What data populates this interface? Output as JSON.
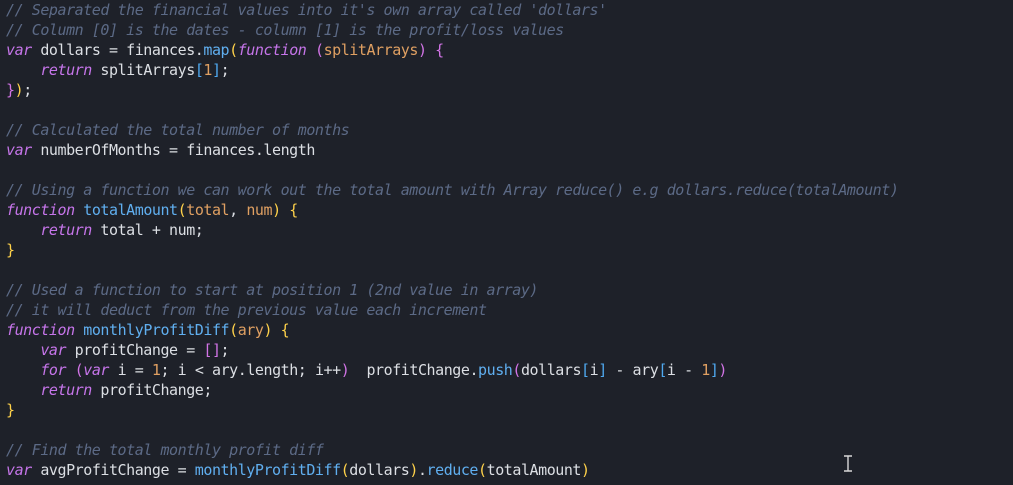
{
  "editor": {
    "lines": [
      [
        {
          "t": "// Separated the financial values into it's own array called 'dollars'",
          "c": "comment"
        }
      ],
      [
        {
          "t": "// Column [0] is the dates - column [1] is the profit/loss values",
          "c": "comment"
        }
      ],
      [
        {
          "t": "var",
          "c": "keyword"
        },
        {
          "t": " dollars = finances.",
          "c": "ident"
        },
        {
          "t": "map",
          "c": "func"
        },
        {
          "t": "(",
          "c": "p1"
        },
        {
          "t": "function",
          "c": "keyword"
        },
        {
          "t": " ",
          "c": "ident"
        },
        {
          "t": "(",
          "c": "p2"
        },
        {
          "t": "splitArrays",
          "c": "param"
        },
        {
          "t": ")",
          "c": "p2"
        },
        {
          "t": " ",
          "c": "ident"
        },
        {
          "t": "{",
          "c": "p2"
        }
      ],
      [
        {
          "t": "    ",
          "c": "ident"
        },
        {
          "t": "return",
          "c": "keyword"
        },
        {
          "t": " splitArrays",
          "c": "ident"
        },
        {
          "t": "[",
          "c": "p3"
        },
        {
          "t": "1",
          "c": "number"
        },
        {
          "t": "]",
          "c": "p3"
        },
        {
          "t": ";",
          "c": "ident"
        }
      ],
      [
        {
          "t": "}",
          "c": "p2"
        },
        {
          "t": ")",
          "c": "p1"
        },
        {
          "t": ";",
          "c": "ident"
        }
      ],
      [
        {
          "t": "",
          "c": "ident"
        }
      ],
      [
        {
          "t": "// Calculated the total number of months",
          "c": "comment"
        }
      ],
      [
        {
          "t": "var",
          "c": "keyword"
        },
        {
          "t": " numberOfMonths = finances.length",
          "c": "ident"
        }
      ],
      [
        {
          "t": "",
          "c": "ident"
        }
      ],
      [
        {
          "t": "// Using a function we can work out the total amount with Array reduce() e.g dollars.reduce(totalAmount)",
          "c": "comment"
        }
      ],
      [
        {
          "t": "function",
          "c": "keyword"
        },
        {
          "t": " ",
          "c": "ident"
        },
        {
          "t": "totalAmount",
          "c": "func"
        },
        {
          "t": "(",
          "c": "p1"
        },
        {
          "t": "total",
          "c": "param"
        },
        {
          "t": ", ",
          "c": "ident"
        },
        {
          "t": "num",
          "c": "param"
        },
        {
          "t": ")",
          "c": "p1"
        },
        {
          "t": " ",
          "c": "ident"
        },
        {
          "t": "{",
          "c": "p1"
        }
      ],
      [
        {
          "t": "    ",
          "c": "ident"
        },
        {
          "t": "return",
          "c": "keyword"
        },
        {
          "t": " total + num;",
          "c": "ident"
        }
      ],
      [
        {
          "t": "}",
          "c": "p1"
        }
      ],
      [
        {
          "t": "",
          "c": "ident"
        }
      ],
      [
        {
          "t": "// Used a function to start at position 1 (2nd value in array)",
          "c": "comment"
        }
      ],
      [
        {
          "t": "// it will deduct from the previous value each increment",
          "c": "comment"
        }
      ],
      [
        {
          "t": "function",
          "c": "keyword"
        },
        {
          "t": " ",
          "c": "ident"
        },
        {
          "t": "monthlyProfitDiff",
          "c": "func"
        },
        {
          "t": "(",
          "c": "p1"
        },
        {
          "t": "ary",
          "c": "param"
        },
        {
          "t": ")",
          "c": "p1"
        },
        {
          "t": " ",
          "c": "ident"
        },
        {
          "t": "{",
          "c": "p1"
        }
      ],
      [
        {
          "t": "    ",
          "c": "ident"
        },
        {
          "t": "var",
          "c": "keyword"
        },
        {
          "t": " profitChange = ",
          "c": "ident"
        },
        {
          "t": "[]",
          "c": "p2"
        },
        {
          "t": ";",
          "c": "ident"
        }
      ],
      [
        {
          "t": "    ",
          "c": "ident"
        },
        {
          "t": "for",
          "c": "keyword"
        },
        {
          "t": " ",
          "c": "ident"
        },
        {
          "t": "(",
          "c": "p2"
        },
        {
          "t": "var",
          "c": "keyword"
        },
        {
          "t": " i = ",
          "c": "ident"
        },
        {
          "t": "1",
          "c": "number"
        },
        {
          "t": "; i < ary.length; i++",
          "c": "ident"
        },
        {
          "t": ")",
          "c": "p2"
        },
        {
          "t": "  profitChange.",
          "c": "ident"
        },
        {
          "t": "push",
          "c": "func"
        },
        {
          "t": "(",
          "c": "p2"
        },
        {
          "t": "dollars",
          "c": "ident"
        },
        {
          "t": "[",
          "c": "p3"
        },
        {
          "t": "i",
          "c": "ident"
        },
        {
          "t": "]",
          "c": "p3"
        },
        {
          "t": " - ary",
          "c": "ident"
        },
        {
          "t": "[",
          "c": "p3"
        },
        {
          "t": "i - ",
          "c": "ident"
        },
        {
          "t": "1",
          "c": "number"
        },
        {
          "t": "]",
          "c": "p3"
        },
        {
          "t": ")",
          "c": "p2"
        }
      ],
      [
        {
          "t": "    ",
          "c": "ident"
        },
        {
          "t": "return",
          "c": "keyword"
        },
        {
          "t": " profitChange;",
          "c": "ident"
        }
      ],
      [
        {
          "t": "}",
          "c": "p1"
        }
      ],
      [
        {
          "t": "",
          "c": "ident"
        }
      ],
      [
        {
          "t": "// Find the total monthly profit diff",
          "c": "comment"
        }
      ],
      [
        {
          "t": "var",
          "c": "keyword"
        },
        {
          "t": " avgProfitChange = ",
          "c": "ident"
        },
        {
          "t": "monthlyProfitDiff",
          "c": "func"
        },
        {
          "t": "(",
          "c": "p1"
        },
        {
          "t": "dollars",
          "c": "ident"
        },
        {
          "t": ")",
          "c": "p1"
        },
        {
          "t": ".",
          "c": "ident"
        },
        {
          "t": "reduce",
          "c": "func"
        },
        {
          "t": "(",
          "c": "p1"
        },
        {
          "t": "totalAmount",
          "c": "ident"
        },
        {
          "t": ")",
          "c": "p1"
        }
      ]
    ]
  },
  "icons": {
    "cursor": "i-beam-cursor-icon"
  },
  "colors": {
    "background": "#1e2129",
    "comment": "#5c6a86",
    "keyword": "#c675ea",
    "function": "#60aff0",
    "parameter": "#e0a062",
    "text": "#dcdfe4"
  }
}
